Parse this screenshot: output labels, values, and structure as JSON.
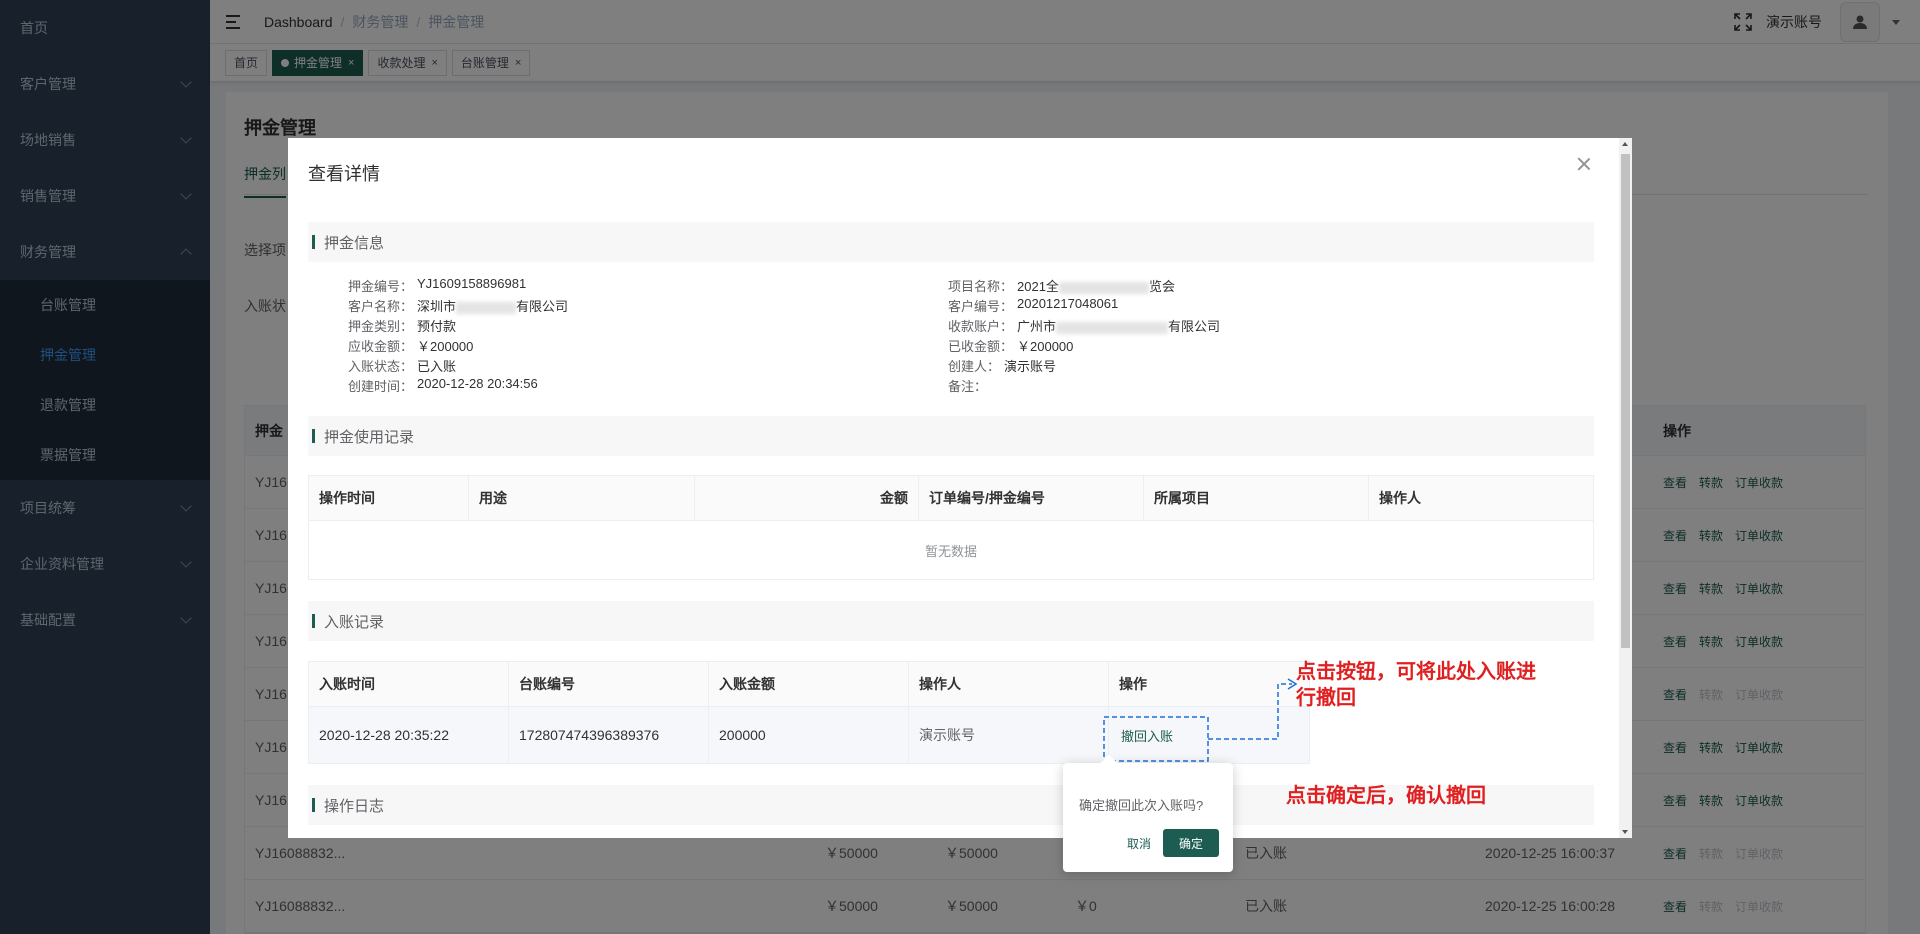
{
  "sidebar": {
    "items": [
      {
        "label": "首页"
      },
      {
        "label": "客户管理"
      },
      {
        "label": "场地销售"
      },
      {
        "label": "销售管理"
      },
      {
        "label": "财务管理"
      },
      {
        "label": "项目统筹"
      },
      {
        "label": "企业资料管理"
      },
      {
        "label": "基础配置"
      }
    ],
    "sub_items": [
      {
        "label": "台账管理"
      },
      {
        "label": "押金管理"
      },
      {
        "label": "退款管理"
      },
      {
        "label": "票据管理"
      }
    ]
  },
  "navbar": {
    "breadcrumb": [
      "Dashboard",
      "财务管理",
      "押金管理"
    ],
    "user_name": "演示账号"
  },
  "tags": [
    "首页",
    "押金管理",
    "收款处理",
    "台账管理"
  ],
  "tag_close": "×",
  "page": {
    "title": "押金管理",
    "tab": "押金列",
    "filter_label_1": "选择项",
    "filter_label_2": "入账状",
    "table_head_first": "押金",
    "table_head_ops": "操作",
    "row_ids": [
      "YJ16",
      "YJ16",
      "YJ16",
      "YJ16",
      "YJ16",
      "YJ16",
      "YJ16",
      "YJ16088832...",
      "YJ16088832..."
    ],
    "ops": {
      "view": "查看",
      "transfer": "转款",
      "order": "订单收款"
    },
    "bottom_rows": [
      {
        "amount1": "￥50000",
        "amount2": "￥50000",
        "status": "已入账",
        "time": "2020-12-25 16:00:37"
      },
      {
        "amount1": "￥50000",
        "amount2": "￥50000",
        "amount3": "￥0",
        "status": "已入账",
        "time": "2020-12-25 16:00:28"
      }
    ]
  },
  "dialog": {
    "title": "查看详情",
    "section_info": "押金信息",
    "info_left": [
      {
        "label": "押金编号：",
        "value": "YJ1609158896981"
      },
      {
        "label": "客户名称：",
        "value": "深圳市",
        "value_tail": "有限公司"
      },
      {
        "label": "押金类别：",
        "value": "预付款"
      },
      {
        "label": "应收金额：",
        "value": "￥200000"
      },
      {
        "label": "入账状态：",
        "value": "已入账"
      },
      {
        "label": "创建时间：",
        "value": "2020-12-28 20:34:56"
      }
    ],
    "info_right": [
      {
        "label": "项目名称：",
        "value": "2021全",
        "value_tail": "览会"
      },
      {
        "label": "客户编号：",
        "value": "20201217048061"
      },
      {
        "label": "收款账户：",
        "value": "广州市",
        "value_tail": "有限公司"
      },
      {
        "label": "已收金额：",
        "value": "￥200000"
      },
      {
        "label": "创建人：",
        "value": "演示账号"
      },
      {
        "label": "备注：",
        "value": ""
      }
    ],
    "section_usage": "押金使用记录",
    "usage_headers": [
      "操作时间",
      "用途",
      "金额",
      "订单编号/押金编号",
      "所属项目",
      "操作人"
    ],
    "usage_empty": "暂无数据",
    "section_entry": "入账记录",
    "entry_headers": [
      "入账时间",
      "台账编号",
      "入账金额",
      "操作人",
      "操作"
    ],
    "entry_row": {
      "time": "2020-12-28 20:35:22",
      "ledger_no": "172807474396389376",
      "amount": "200000",
      "operator": "演示账号",
      "action": "撤回入账"
    },
    "section_log": "操作日志"
  },
  "popconfirm": {
    "message": "确定撤回此次入账吗?",
    "cancel": "取消",
    "confirm": "确定"
  },
  "annotations": {
    "first": "点击按钮，可将此处入账进行撤回",
    "second": "点击确定后，确认撤回"
  },
  "colors": {
    "primary": "#1d5c50",
    "annotation": "#e02020",
    "sidebar_bg": "#304156"
  }
}
